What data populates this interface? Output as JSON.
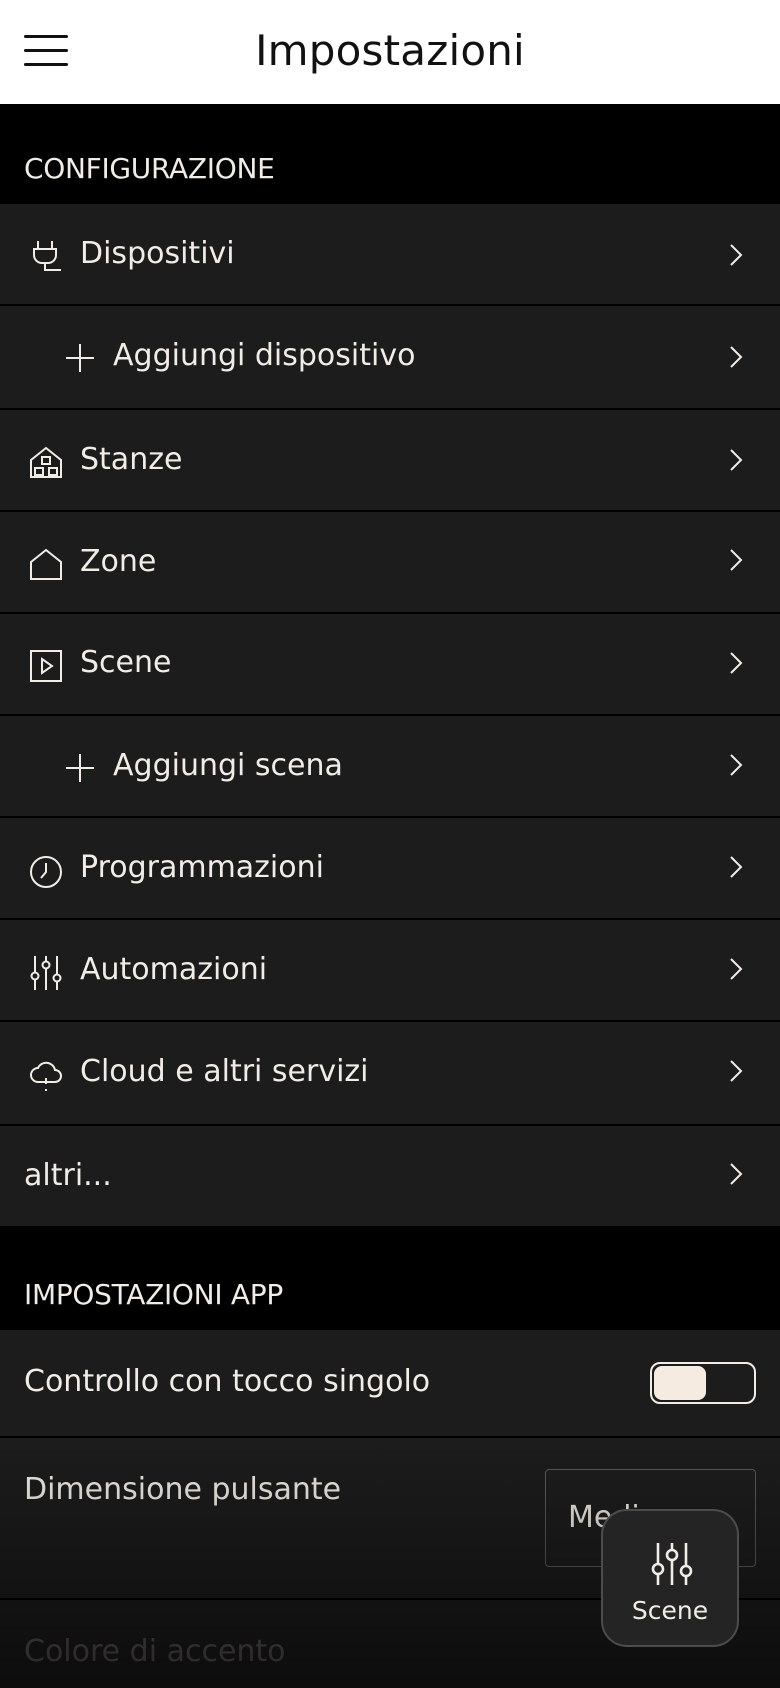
{
  "header": {
    "title": "Impostazioni",
    "menu_icon": "hamburger-menu-icon"
  },
  "sections": {
    "configurazione": "CONFIGURAZIONE",
    "impostazioni_app": "IMPOSTAZIONI APP"
  },
  "config_items": [
    {
      "label": "Dispositivi",
      "icon": "plug-icon"
    },
    {
      "label": "Aggiungi dispositivo",
      "icon": "plus-icon"
    },
    {
      "label": "Stanze",
      "icon": "house-rooms-icon"
    },
    {
      "label": "Zone",
      "icon": "house-outline-icon"
    },
    {
      "label": "Scene",
      "icon": "play-square-icon"
    },
    {
      "label": "Aggiungi scena",
      "icon": "plus-icon"
    },
    {
      "label": "Programmazioni",
      "icon": "clock-icon"
    },
    {
      "label": "Automazioni",
      "icon": "sliders-icon"
    },
    {
      "label": "Cloud e altri servizi",
      "icon": "cloud-icon"
    },
    {
      "label": "altri..."
    }
  ],
  "app_settings": {
    "single_tap_label": "Controllo con tocco singolo",
    "single_tap_enabled": false,
    "button_size_label": "Dimensione pulsante",
    "button_size_value": "Medio",
    "accent_color_label": "Colore di accento"
  },
  "fab": {
    "label": "Scene",
    "icon": "sliders-icon"
  },
  "colors": {
    "background": "#000000",
    "row": "#1c1c1c",
    "header": "#ffffff",
    "text": "#f1ece6",
    "knob": "#f6ebe0"
  }
}
